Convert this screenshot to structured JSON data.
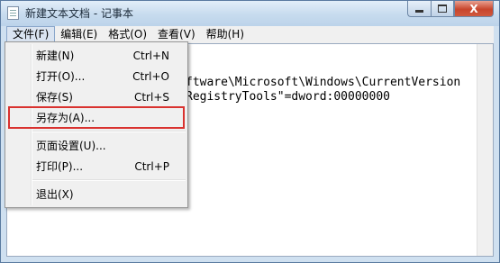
{
  "window": {
    "title": "新建文本文档 - 记事本",
    "close_symbol": "X"
  },
  "menubar": [
    {
      "label": "文件(F)"
    },
    {
      "label": "编辑(E)"
    },
    {
      "label": "格式(O)"
    },
    {
      "label": "查看(V)"
    },
    {
      "label": "帮助(H)"
    }
  ],
  "editor": {
    "line1": "ftware\\Microsoft\\Windows\\CurrentVersion",
    "line2": "RegistryTools\"=dword:00000000"
  },
  "file_menu": {
    "items": [
      {
        "label": "新建(N)",
        "shortcut": "Ctrl+N"
      },
      {
        "label": "打开(O)...",
        "shortcut": "Ctrl+O"
      },
      {
        "label": "保存(S)",
        "shortcut": "Ctrl+S"
      },
      {
        "label": "另存为(A)...",
        "shortcut": ""
      },
      {
        "label": "页面设置(U)...",
        "shortcut": ""
      },
      {
        "label": "打印(P)...",
        "shortcut": "Ctrl+P"
      },
      {
        "label": "退出(X)",
        "shortcut": ""
      }
    ]
  },
  "colors": {
    "highlight_box": "#d9322f",
    "close_button": "#c8452c"
  }
}
